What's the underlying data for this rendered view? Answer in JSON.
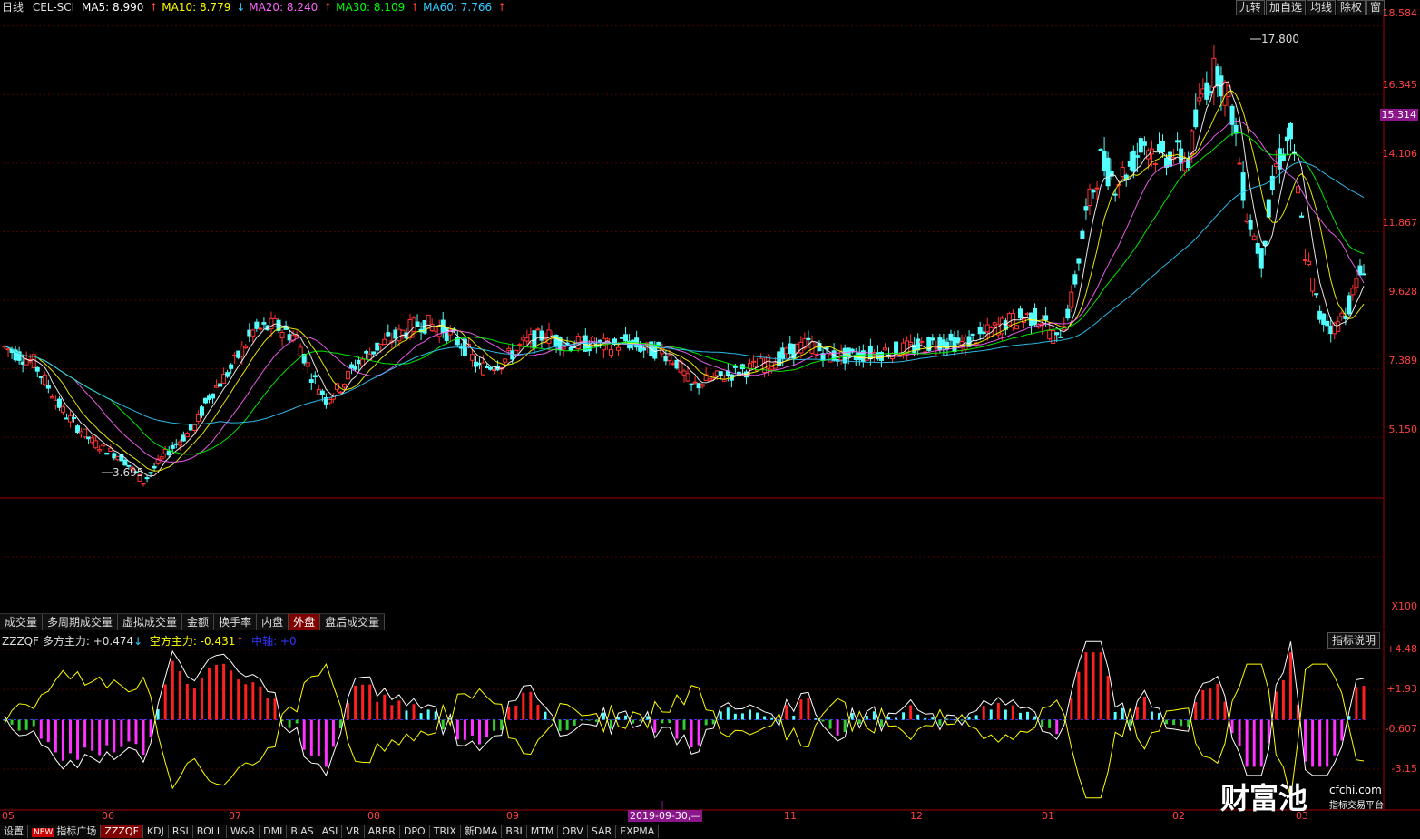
{
  "header": {
    "period": "日线",
    "symbol": "CEL-SCI",
    "ma": [
      {
        "label": "MA5: 8.990",
        "arrow": "↑",
        "color": "#ffffff"
      },
      {
        "label": "MA10: 8.779",
        "arrow": "↓",
        "color": "#ffff00"
      },
      {
        "label": "MA20: 8.240",
        "arrow": "↑",
        "color": "#ff66ff"
      },
      {
        "label": "MA30: 8.109",
        "arrow": "↑",
        "color": "#00ff00"
      },
      {
        "label": "MA60: 7.766",
        "arrow": "↑",
        "color": "#33ccff"
      }
    ],
    "buttons": [
      "九转",
      "加自选",
      "均线",
      "除权",
      "窗"
    ]
  },
  "price_axis": [
    "18.584",
    "16.345",
    "14.106",
    "11.867",
    "9.628",
    "7.389",
    "5.150"
  ],
  "current_price": "15.314",
  "high_label": "17.800",
  "low_label": "3.695",
  "volume_axis_label": "X100",
  "volume_tabs": [
    "成交量",
    "多周期成交量",
    "虚拟成交量",
    "金额",
    "换手率",
    "内盘",
    "外盘",
    "盘后成交量"
  ],
  "volume_tab_active": "外盘",
  "indicator": {
    "name": "ZZZQF",
    "long_label": "多方主力: +0.474",
    "long_arrow": "↓",
    "short_label": "空方主力: -0.431",
    "short_arrow": "↑",
    "mid_label": "中轴: +0",
    "explain_button": "指标说明",
    "axis": [
      "+4.48",
      "+1.93",
      "-0.607",
      "-3.15"
    ]
  },
  "x_axis": [
    "05",
    "06",
    "07",
    "08",
    "09",
    "10",
    "11",
    "12",
    "01",
    "02",
    "03"
  ],
  "date_marker": "2019-09-30,—",
  "bottom_tabs": {
    "settings": "设置",
    "new_badge": "NEW",
    "items": [
      "指标广场",
      "ZZZQF",
      "KDJ",
      "RSI",
      "BOLL",
      "W&R",
      "DMI",
      "BIAS",
      "ASI",
      "VR",
      "ARBR",
      "DPO",
      "TRIX",
      "新DMA",
      "BBI",
      "MTM",
      "OBV",
      "SAR",
      "EXPMA"
    ],
    "active": "ZZZQF"
  },
  "watermark": {
    "name": "财富池",
    "domain": "cfchi.com",
    "tagline": "指标交易平台"
  },
  "chart_data": {
    "type": "candlestick",
    "ylim": [
      3.2,
      18.9
    ],
    "price_path": [
      [
        0,
        8.1
      ],
      [
        8,
        7.6
      ],
      [
        16,
        6.0
      ],
      [
        24,
        5.0
      ],
      [
        32,
        4.5
      ],
      [
        38,
        3.7
      ],
      [
        44,
        4.6
      ],
      [
        52,
        5.5
      ],
      [
        56,
        6.5
      ],
      [
        62,
        7.4
      ],
      [
        68,
        8.6
      ],
      [
        74,
        8.8
      ],
      [
        80,
        8.4
      ],
      [
        84,
        7.2
      ],
      [
        88,
        6.4
      ],
      [
        92,
        6.8
      ],
      [
        96,
        7.5
      ],
      [
        102,
        8.1
      ],
      [
        108,
        8.5
      ],
      [
        114,
        8.9
      ],
      [
        120,
        8.7
      ],
      [
        126,
        8.1
      ],
      [
        130,
        7.4
      ],
      [
        136,
        7.6
      ],
      [
        142,
        8.2
      ],
      [
        148,
        8.5
      ],
      [
        154,
        8.2
      ],
      [
        160,
        8.2
      ],
      [
        166,
        8.1
      ],
      [
        170,
        8.3
      ],
      [
        176,
        8.0
      ],
      [
        180,
        8.0
      ],
      [
        184,
        7.6
      ],
      [
        188,
        6.8
      ],
      [
        192,
        7.0
      ],
      [
        198,
        7.2
      ],
      [
        204,
        7.4
      ],
      [
        210,
        7.6
      ],
      [
        216,
        8.0
      ],
      [
        220,
        8.2
      ],
      [
        226,
        7.8
      ],
      [
        232,
        7.8
      ],
      [
        238,
        7.9
      ],
      [
        244,
        8.0
      ],
      [
        250,
        8.1
      ],
      [
        256,
        8.3
      ],
      [
        262,
        8.2
      ],
      [
        268,
        8.5
      ],
      [
        274,
        8.9
      ],
      [
        280,
        9.1
      ],
      [
        284,
        9.0
      ],
      [
        288,
        8.3
      ],
      [
        292,
        9.6
      ],
      [
        296,
        12.4
      ],
      [
        300,
        14.2
      ],
      [
        304,
        13.5
      ],
      [
        308,
        14.0
      ],
      [
        312,
        14.8
      ],
      [
        316,
        14.3
      ],
      [
        320,
        14.4
      ],
      [
        324,
        14.2
      ],
      [
        328,
        16.5
      ],
      [
        332,
        17.2
      ],
      [
        336,
        15.8
      ],
      [
        340,
        12.5
      ],
      [
        344,
        11.0
      ],
      [
        348,
        14.0
      ],
      [
        352,
        15.0
      ],
      [
        356,
        11.2
      ],
      [
        360,
        9.1
      ],
      [
        364,
        8.7
      ],
      [
        368,
        9.5
      ],
      [
        372,
        10.8
      ]
    ],
    "ma_lines": [
      {
        "name": "MA5",
        "color": "#ffffff"
      },
      {
        "name": "MA10",
        "color": "#ffff00"
      },
      {
        "name": "MA20",
        "color": "#ff66ff"
      },
      {
        "name": "MA30",
        "color": "#00ff00"
      },
      {
        "name": "MA60",
        "color": "#33ccff"
      }
    ],
    "indicator_ylim": [
      -3.15,
      4.48
    ]
  }
}
